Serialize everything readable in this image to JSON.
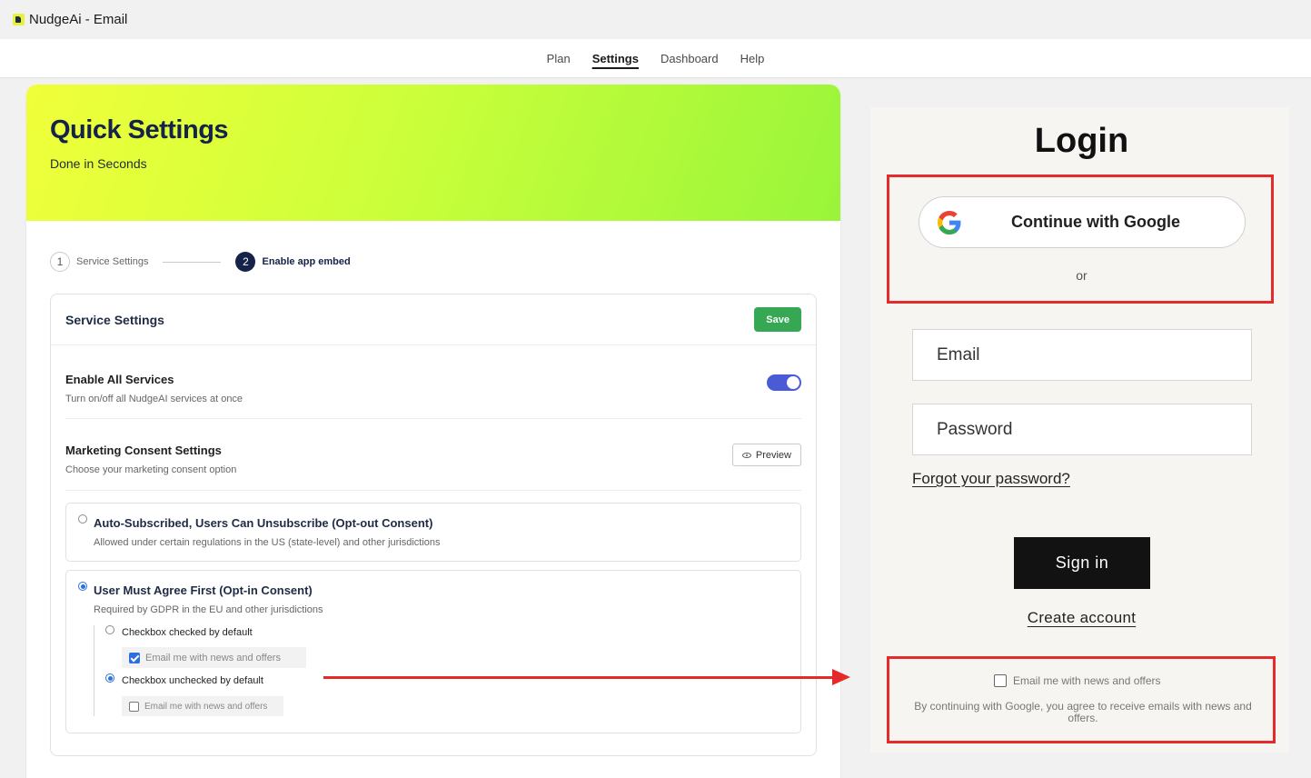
{
  "app": {
    "title": "NudgeAi - Email"
  },
  "nav": {
    "items": [
      "Plan",
      "Settings",
      "Dashboard",
      "Help"
    ],
    "active": "Settings"
  },
  "hero": {
    "title": "Quick Settings",
    "subtitle": "Done in Seconds"
  },
  "stepper": {
    "steps": [
      {
        "number": "1",
        "label": "Service Settings",
        "state": "inactive"
      },
      {
        "number": "2",
        "label": "Enable app embed",
        "state": "active"
      }
    ]
  },
  "service_settings": {
    "title": "Service Settings",
    "save_label": "Save",
    "enable_all": {
      "label": "Enable All Services",
      "help": "Turn on/off all NudgeAI services at once",
      "enabled": true
    },
    "marketing": {
      "label": "Marketing Consent Settings",
      "help": "Choose your marketing consent option",
      "preview_label": "Preview"
    },
    "options": [
      {
        "title": "Auto-Subscribed, Users Can Unsubscribe (Opt-out Consent)",
        "help": "Allowed under certain regulations in the US (state-level) and other jurisdictions",
        "selected": false
      },
      {
        "title": "User Must Agree First (Opt-in Consent)",
        "help": "Required by GDPR in the EU and other jurisdictions",
        "selected": true,
        "sub_options": [
          {
            "label": "Checkbox checked by default",
            "sample": "Email me with news and offers",
            "selected": false,
            "sample_checked": true
          },
          {
            "label": "Checkbox unchecked by default",
            "sample": "Email me with news and offers",
            "selected": true,
            "sample_checked": false
          }
        ]
      }
    ]
  },
  "login": {
    "title": "Login",
    "google_label": "Continue with Google",
    "or_text": "or",
    "email_placeholder": "Email",
    "password_placeholder": "Password",
    "forgot_label": "Forgot your password?",
    "signin_label": "Sign in",
    "create_label": "Create account",
    "consent_label": "Email me with news and offers",
    "consent_note": "By continuing with Google, you agree to receive emails with news and offers."
  },
  "colors": {
    "accent_green": "#36a853",
    "toggle_blue": "#4b5bd6",
    "annotation_red": "#e52a2a",
    "hero_dark": "#15234a"
  }
}
